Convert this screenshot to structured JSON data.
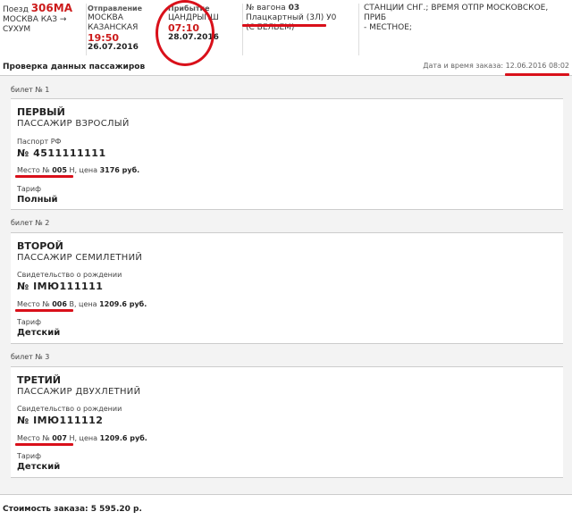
{
  "header": {
    "train_label": "Поезд",
    "train_number": "306МА",
    "route_from": "МОСКВА КАЗ →",
    "route_to": "СУХУМ",
    "departure_label": "Отправление",
    "departure_station_1": "МОСКВА",
    "departure_station_2": "КАЗАНСКАЯ",
    "departure_time": "19:50",
    "departure_date": "26.07.2016",
    "arrival_label": "Прибытие",
    "arrival_station": "ЦАНДРЫПШ",
    "arrival_time": "07:10",
    "arrival_date": "28.07.2016",
    "car_label": "№ вагона",
    "car_number": "03",
    "car_type": "Плацкартный (3Л) У0",
    "car_extra": "(С БЕЛЬЕМ)",
    "note_line1": "СТАНЦИИ СНГ.; ВРЕМЯ ОТПР МОСКОВСКОЕ, ПРИБ",
    "note_line2": "- МЕСТНОЕ;"
  },
  "title": "Проверка данных пассажиров",
  "order_date_label": "Дата и время заказа:",
  "order_date_value": "12.06.2016 08:02",
  "seat_label": "Место №",
  "price_label": ", цена",
  "tariff_label": "Тариф",
  "tickets": [
    {
      "ticket_label": "билет № 1",
      "surname": "ПЕРВЫЙ",
      "passenger_type": "ПАССАЖИР ВЗРОСЛЫЙ",
      "doc_type": "Паспорт РФ",
      "doc_number": "№ 4511111111",
      "seat": "005",
      "seat_suffix": "Н",
      "price": "3176 руб.",
      "tariff": "Полный"
    },
    {
      "ticket_label": "билет № 2",
      "surname": "ВТОРОЙ",
      "passenger_type": "ПАССАЖИР СЕМИЛЕТНИЙ",
      "doc_type": "Свидетельство о рождении",
      "doc_number": "№ IМЮ111111",
      "seat": "006",
      "seat_suffix": "В",
      "price": "1209.6 руб.",
      "tariff": "Детский"
    },
    {
      "ticket_label": "билет № 3",
      "surname": "ТРЕТИЙ",
      "passenger_type": "ПАССАЖИР ДВУХЛЕТНИЙ",
      "doc_type": "Свидетельство о рождении",
      "doc_number": "№ IМЮ111112",
      "seat": "007",
      "seat_suffix": "Н",
      "price": "1209.6 руб.",
      "tariff": "Детский"
    }
  ],
  "total_label": "Стоимость заказа:",
  "total_value": "5 595.20 р.",
  "colors": {
    "accent": "#cc1b1b",
    "annotation": "#d9101a"
  }
}
